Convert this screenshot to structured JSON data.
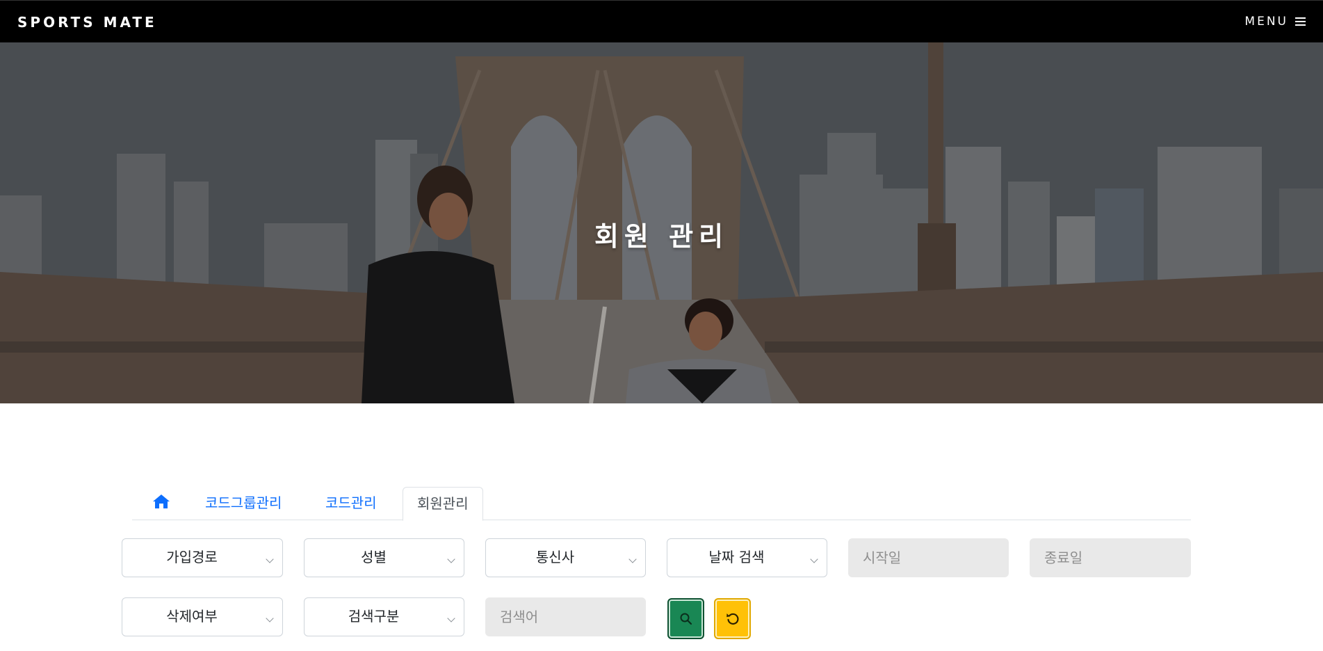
{
  "nav": {
    "brand": "SPORTS MATE",
    "menu_label": "MENU"
  },
  "hero": {
    "title": "회원 관리"
  },
  "tabs": [
    {
      "label": "코드그룹관리",
      "active": false
    },
    {
      "label": "코드관리",
      "active": false
    },
    {
      "label": "회원관리",
      "active": true
    }
  ],
  "filters": {
    "join_route": "가입경로",
    "gender": "성별",
    "carrier": "통신사",
    "date_search": "날짜 검색",
    "start_date_placeholder": "시작일",
    "end_date_placeholder": "종료일",
    "delete_status": "삭제여부",
    "search_type": "검색구분",
    "keyword_placeholder": "검색어"
  },
  "icons": {
    "home": "home-icon",
    "search": "search-icon",
    "reset": "reset-icon",
    "menu": "menu-icon"
  },
  "colors": {
    "nav_bg": "#000000",
    "tab_link": "#0d6efd",
    "search_button": "#198754",
    "reset_button": "#ffc107",
    "input_bg": "#e9e9e9"
  }
}
